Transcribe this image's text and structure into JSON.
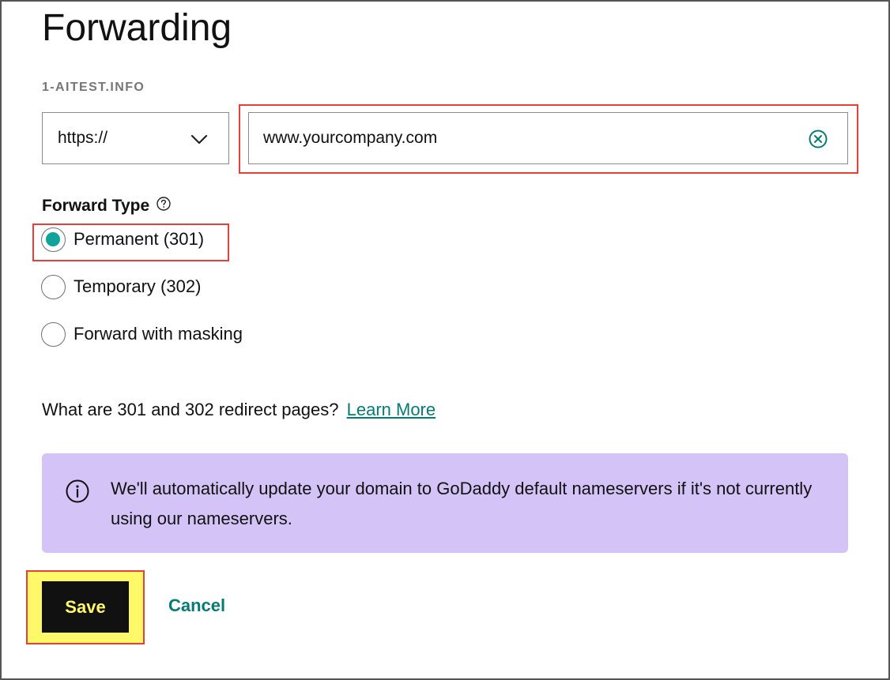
{
  "page": {
    "title": "Forwarding",
    "domain": "1-AITEST.INFO"
  },
  "forwarding": {
    "protocol": "https://",
    "url_value": "www.yourcompany.com"
  },
  "forward_type": {
    "label": "Forward Type",
    "options": [
      {
        "label": "Permanent (301)",
        "checked": true
      },
      {
        "label": "Temporary (302)",
        "checked": false
      },
      {
        "label": "Forward with masking",
        "checked": false
      }
    ]
  },
  "redirect_help": {
    "question": "What are 301 and 302 redirect pages?",
    "link": "Learn More"
  },
  "info_banner": {
    "text": "We'll automatically update your domain to GoDaddy default nameservers if it's not currently using our nameservers."
  },
  "actions": {
    "save_label": "Save",
    "cancel_label": "Cancel"
  },
  "colors": {
    "accent": "#10a39b",
    "link": "#087a75",
    "banner_bg": "#d4c3f7",
    "annotation_red": "#e5413a",
    "annotation_yellow": "#fff96a"
  }
}
